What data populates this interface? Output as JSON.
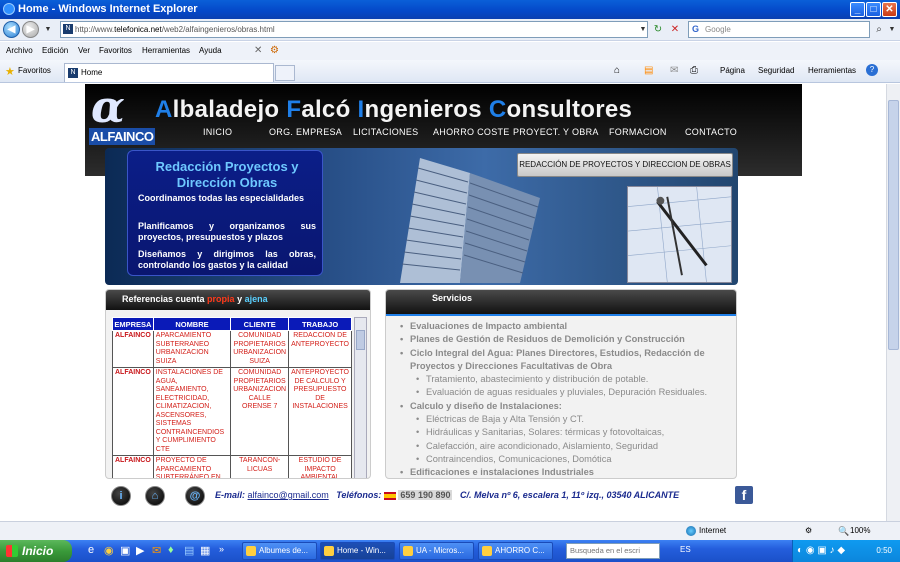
{
  "window": {
    "title": "Home - Windows Internet Explorer"
  },
  "addressbar": {
    "url_prefix": "http://www.",
    "url_domain": "telefonica.net",
    "url_path": "/web2/alfaingenieros/obras.html",
    "search_placeholder": "Google"
  },
  "menubar": {
    "items": [
      "Archivo",
      "Edición",
      "Ver",
      "Favoritos",
      "Herramientas",
      "Ayuda"
    ]
  },
  "favbar": {
    "favorites_label": "Favoritos",
    "tab_title": "Home",
    "tools": [
      "Página",
      "Seguridad",
      "Herramientas"
    ]
  },
  "site": {
    "logo_symbol": "α",
    "logo_text": "ALFAINCO",
    "title_parts": [
      {
        "text": "A",
        "accent": true
      },
      {
        "text": "lbaladejo ",
        "accent": false
      },
      {
        "text": "F",
        "accent": true
      },
      {
        "text": "alcó ",
        "accent": false
      },
      {
        "text": "I",
        "accent": true
      },
      {
        "text": "ngenieros ",
        "accent": false
      },
      {
        "text": "C",
        "accent": true
      },
      {
        "text": "onsultores",
        "accent": false
      }
    ],
    "accent_color": "#1f7fe8",
    "nav": [
      "INICIO",
      "ORG. EMPRESA",
      "LICITACIONES",
      "AHORRO COSTE",
      "PROYECT. Y OBRA",
      "FORMACION",
      "CONTACTO"
    ]
  },
  "banner": {
    "heading": "Redacción Proyectos y Dirección Obras",
    "paragraphs": [
      "Coordinamos todas las especialidades",
      "Planificamos y organizamos sus proyectos, presupuestos y plazos",
      "Diseñamos y dirigimos las obras, controlando los gastos y la calidad"
    ],
    "button_label": "REDACCIÓN DE PROYECTOS Y DIRECCION DE OBRAS"
  },
  "references": {
    "title_prefix": "Referencias cuenta ",
    "title_red": "propia",
    "title_mid": " y ",
    "title_blue": "ajena",
    "headers": [
      "EMPRESA",
      "NOMBRE",
      "CLIENTE",
      "TRABAJO"
    ],
    "rows": [
      [
        "ALFAINCO",
        "APARCAMIENTO SUBTERRANEO URBANIZACION SUIZA",
        "COMUNIDAD PROPIETARIOS URBANIZACION SUIZA",
        "REDACCION DE ANTEPROYECTO"
      ],
      [
        "ALFAINCO",
        "INSTALACIONES DE AGUA, SANEAMIENTO, ELECTRICIDAD, CLIMATIZACION, ASCENSORES, SISTEMAS CONTRAINCENDIOS Y CUMPLIMIENTO CTE",
        "COMUNIDAD PROPIETARIOS URBANIZACION CALLE ORENSE 7",
        "ANTEPROYECTO DE CALCULO Y PRESUPUESTO DE INSTALACIONES"
      ],
      [
        "ALFAINCO",
        "PROYECTO DE APARCAMIENTO SUBTERRÁNEO EN PLAZA SÉNECA ALICANTE",
        "TARANCON-LICUAS",
        "ESTUDIO DE IMPACTO AMBIENTAL"
      ]
    ]
  },
  "services": {
    "title": "Servicios",
    "items": [
      {
        "text": "Evaluaciones de Impacto ambiental",
        "level": 0
      },
      {
        "text": "Planes de Gestión de Residuos de Demolición y Construcción",
        "level": 0
      },
      {
        "text": "Ciclo Integral del Agua: Planes Directores, Estudios, Redacción de Proyectos y Direcciones Facultativas de Obra",
        "level": 0
      },
      {
        "text": "Tratamiento, abastecimiento y distribución de potable.",
        "level": 1
      },
      {
        "text": "Evaluación de aguas residuales y pluviales, Depuración Residuales.",
        "level": 1
      },
      {
        "text": "Calculo y diseño de Instalaciones:",
        "level": 0
      },
      {
        "text": "Eléctricas de Baja y Alta Tensión y CT.",
        "level": 1
      },
      {
        "text": "Hidráulicas y Sanitarias, Solares: térmicas y fotovoltaicas,",
        "level": 1
      },
      {
        "text": "Calefacción, aire acondicionado, Aislamiento, Seguridad",
        "level": 1
      },
      {
        "text": "Contraincendios, Comunicaciones,  Domótica",
        "level": 1
      },
      {
        "text": "Edificaciones e instalaciones Industriales",
        "level": 0
      }
    ]
  },
  "footer": {
    "email_label": "E-mail:",
    "email": "alfainco@gmail.com",
    "phone_label": "Teléfonos:",
    "phone": "659 190 890",
    "address": "C/. Melva nº 6, escalera 1, 11º izq., 03540 ALICANTE",
    "facebook": "f"
  },
  "statusbar": {
    "zone": "Internet",
    "zoom": "100%"
  },
  "taskbar": {
    "start": "Inicio",
    "tasks": [
      "Albumes de...",
      "Home - Win...",
      "UA - Micros...",
      "AHORRO C..."
    ],
    "search_placeholder": "Busqueda en el escri",
    "lang": "ES",
    "clock": "0:50"
  }
}
